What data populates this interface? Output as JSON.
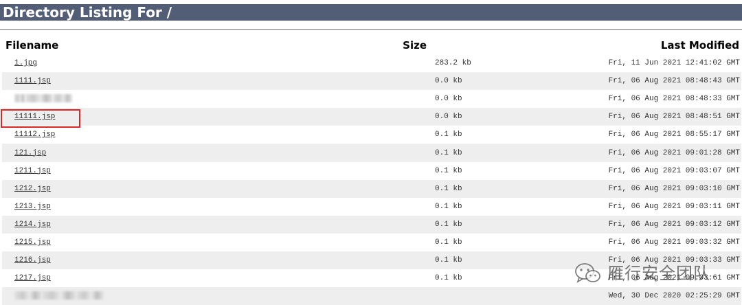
{
  "page": {
    "title": "Directory Listing For /"
  },
  "table": {
    "headers": {
      "filename": "Filename",
      "size": "Size",
      "modified": "Last Modified"
    },
    "rows": [
      {
        "name": "1.jpg",
        "size": "283.2 kb",
        "modified": "Fri, 11 Jun 2021 12:41:02 GMT",
        "obscured": false
      },
      {
        "name": "1111.jsp",
        "size": "0.0 kb",
        "modified": "Fri, 06 Aug 2021 08:48:43 GMT",
        "obscured": false
      },
      {
        "name": "",
        "size": "0.0 kb",
        "modified": "Fri, 06 Aug 2021 08:48:33 GMT",
        "obscured": true
      },
      {
        "name": "11111.jsp",
        "size": "0.0 kb",
        "modified": "Fri, 06 Aug 2021 08:48:51 GMT",
        "obscured": false
      },
      {
        "name": "11112.jsp",
        "size": "0.1 kb",
        "modified": "Fri, 06 Aug 2021 08:55:17 GMT",
        "obscured": false
      },
      {
        "name": "121.jsp",
        "size": "0.1 kb",
        "modified": "Fri, 06 Aug 2021 09:01:28 GMT",
        "obscured": false
      },
      {
        "name": "1211.jsp",
        "size": "0.1 kb",
        "modified": "Fri, 06 Aug 2021 09:03:07 GMT",
        "obscured": false
      },
      {
        "name": "1212.jsp",
        "size": "0.1 kb",
        "modified": "Fri, 06 Aug 2021 09:03:10 GMT",
        "obscured": false
      },
      {
        "name": "1213.jsp",
        "size": "0.1 kb",
        "modified": "Fri, 06 Aug 2021 09:03:11 GMT",
        "obscured": false
      },
      {
        "name": "1214.jsp",
        "size": "0.1 kb",
        "modified": "Fri, 06 Aug 2021 09:03:12 GMT",
        "obscured": false
      },
      {
        "name": "1215.jsp",
        "size": "0.1 kb",
        "modified": "Fri, 06 Aug 2021 09:03:32 GMT",
        "obscured": false
      },
      {
        "name": "1216.jsp",
        "size": "0.1 kb",
        "modified": "Fri, 06 Aug 2021 09:03:33 GMT",
        "obscured": false
      },
      {
        "name": "1217.jsp",
        "size": "0.1 kb",
        "modified": "Fri, 06 Aug 2021 09:03:61 GMT",
        "obscured": false
      },
      {
        "name": "",
        "size": "",
        "modified": "Wed, 30 Dec 2020 02:25:29 GMT",
        "obscured": true
      }
    ]
  },
  "highlight": {
    "target": "11111.jsp",
    "color": "#e02424"
  },
  "watermark": {
    "text": "雁行安全团队",
    "icon": "wechat-icon"
  },
  "colors": {
    "header_bg": "#525d76",
    "row_alt": "#eeeeee"
  }
}
